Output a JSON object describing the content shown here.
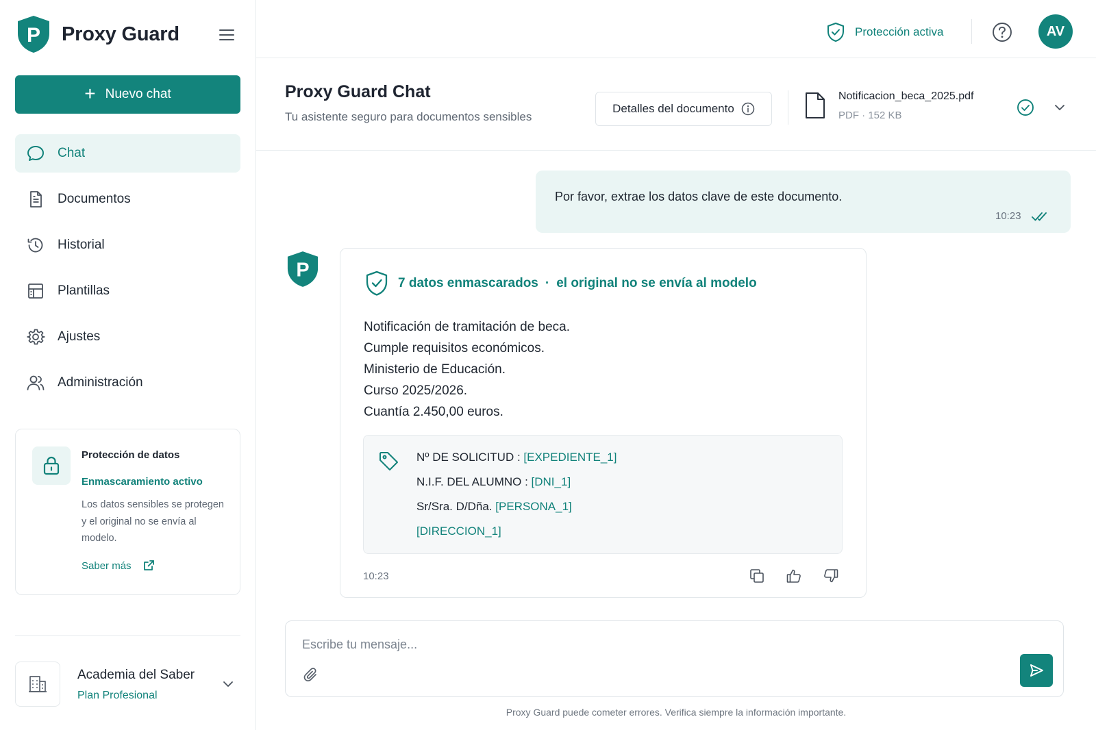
{
  "brand": {
    "name": "Proxy Guard",
    "logo_letter": "P"
  },
  "sidebar": {
    "new_chat_label": "Nuevo chat",
    "items": [
      {
        "label": "Chat",
        "icon": "chat-bubble-icon",
        "active": true
      },
      {
        "label": "Documentos",
        "icon": "document-icon"
      },
      {
        "label": "Historial",
        "icon": "history-icon"
      },
      {
        "label": "Plantillas",
        "icon": "template-icon"
      },
      {
        "label": "Ajustes",
        "icon": "gear-icon"
      },
      {
        "label": "Administración",
        "icon": "users-icon"
      }
    ],
    "protection_card": {
      "title": "Protección de datos",
      "status": "Enmascaramiento activo",
      "description": "Los datos sensibles se protegen y el original no se envía al modelo.",
      "link_label": "Saber más"
    },
    "org": {
      "name": "Academia del Saber",
      "plan": "Plan Profesional"
    }
  },
  "topbar": {
    "protection_label": "Protección activa",
    "avatar_initials": "AV"
  },
  "chat_header": {
    "title": "Proxy Guard Chat",
    "subtitle": "Tu asistente seguro para documentos sensibles",
    "details_button": "Detalles del documento",
    "file": {
      "name": "Notificacion_beca_2025.pdf",
      "type": "PDF",
      "size": "152 KB"
    }
  },
  "messages": {
    "user": {
      "text": "Por favor, extrae los datos clave de este documento.",
      "time": "10:23"
    },
    "bot": {
      "mask_count": "7 datos enmascarados",
      "mask_note": "el original no se envía al modelo",
      "lines": [
        "Notificación de tramitación de beca.",
        "Cumple requisitos económicos.",
        "Ministerio de Educación.",
        "Curso 2025/2026.",
        "Cuantía 2.450,00 euros."
      ],
      "fields": [
        {
          "label": "Nº DE SOLICITUD : ",
          "token": "[EXPEDIENTE_1]"
        },
        {
          "label": "N.I.F. DEL ALUMNO : ",
          "token": "[DNI_1]"
        },
        {
          "label": "Sr/Sra. D/Dña. ",
          "token": "[PERSONA_1]"
        },
        {
          "label": "",
          "token": "[DIRECCION_1]"
        }
      ],
      "time": "10:23"
    }
  },
  "composer": {
    "placeholder": "Escribe tu mensaje...",
    "disclaimer": "Proxy Guard puede cometer errores. Verifica siempre la información importante."
  },
  "colors": {
    "accent": "#13847c",
    "accent_text": "#11827a",
    "accent_soft": "#eaf5f4"
  }
}
